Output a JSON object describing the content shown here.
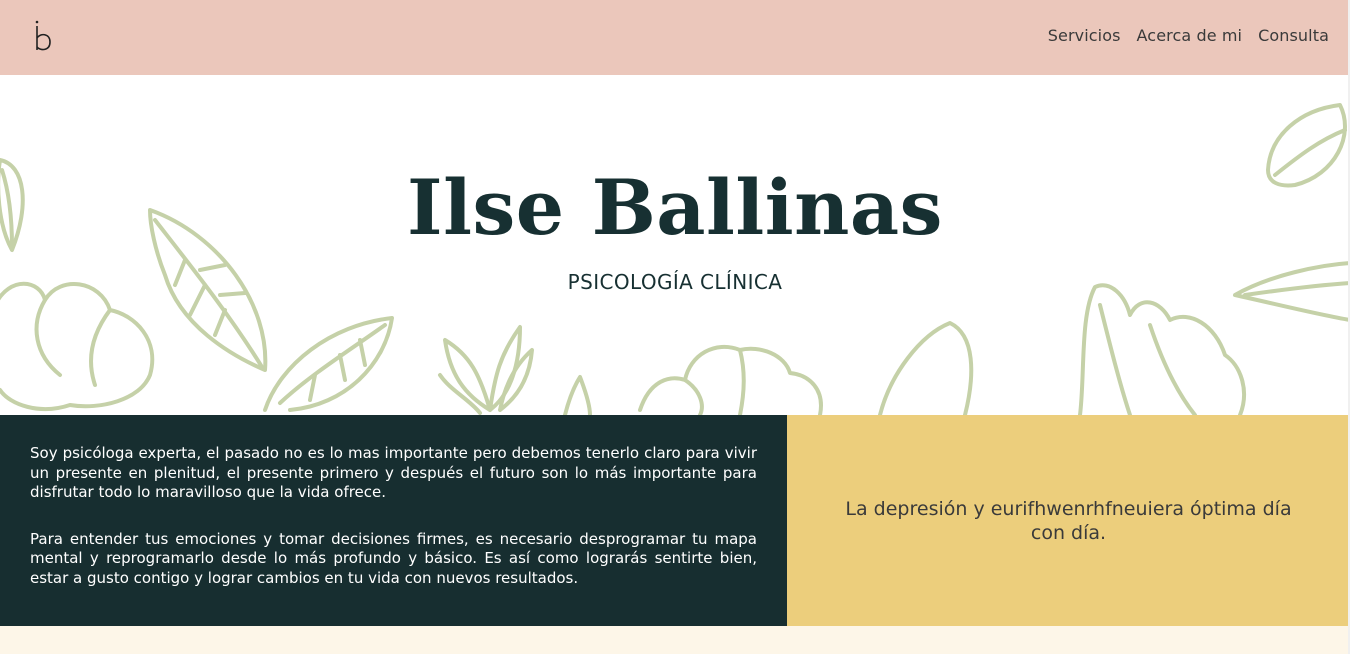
{
  "header": {
    "logo_letter": "b",
    "nav": [
      {
        "label": "Servicios"
      },
      {
        "label": "Acerca de mi"
      },
      {
        "label": "Consulta"
      }
    ]
  },
  "hero": {
    "title": "Ilse Ballinas",
    "subtitle": "PSICOLOGÍA CLÍNICA"
  },
  "about": {
    "paragraph_1": "Soy psicóloga experta, el pasado no es lo mas importante pero debemos tenerlo claro para vivir un presente en plenitud, el presente primero y después el futuro son lo más importante para disfrutar todo lo maravilloso que la vida ofrece.",
    "paragraph_2": "Para entender tus emociones y tomar decisiones firmes, es necesario desprogramar tu mapa mental y reprogramarlo desde lo más profundo y básico. Es así como lograrás sentirte bien, estar a gusto contigo y lograr cambios en tu vida con nuevos resultados."
  },
  "highlight": {
    "text": "La depresión y eurifhwenrhfneuiera óptima día con día."
  },
  "colors": {
    "header_bg": "#ebc7bb",
    "dark_panel": "#172e30",
    "yellow_panel": "#ecce7c",
    "leaf_line": "#c5d1a8",
    "footer_bg": "#fdf6e8"
  }
}
